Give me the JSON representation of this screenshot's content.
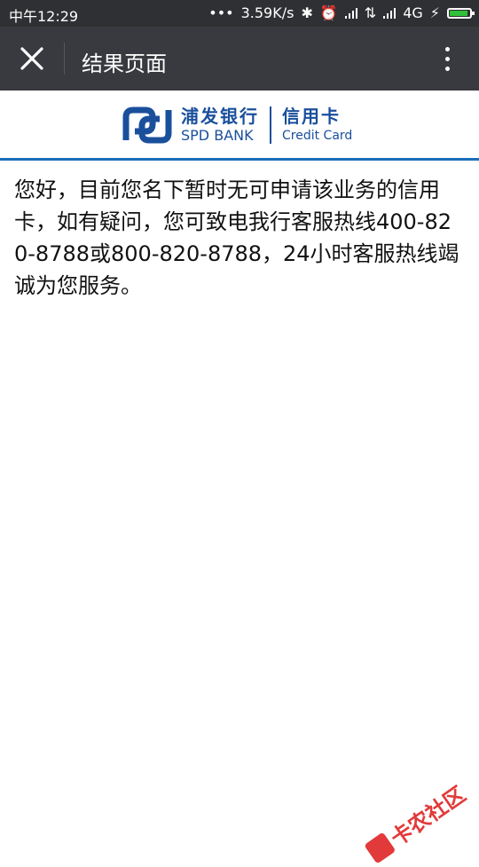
{
  "status_bar": {
    "time": "中午12:29",
    "network_speed": "3.59K/s",
    "network_type": "4G",
    "icons": [
      "dots-icon",
      "bluetooth-icon",
      "alarm-icon",
      "signal-icon",
      "data-arrows-icon",
      "signal-icon",
      "lightning-icon",
      "battery-icon"
    ]
  },
  "title_bar": {
    "title": "结果页面",
    "close_icon": "close-icon",
    "more_icon": "more-vertical-icon"
  },
  "bank_header": {
    "name_cn": "浦发银行",
    "name_en": "SPD BANK",
    "card_cn": "信用卡",
    "card_en": "Credit Card",
    "brand_color": "#1a4f9c",
    "underline_color": "#1a6eb8"
  },
  "message": "您好，目前您名下暂时无可申请该业务的信用卡，如有疑问，您可致电我行客服热线400-820-8788或800-820-8788，24小时客服热线竭诚为您服务。",
  "watermark": {
    "text": "卡农社区",
    "color": "#e23a3a"
  }
}
